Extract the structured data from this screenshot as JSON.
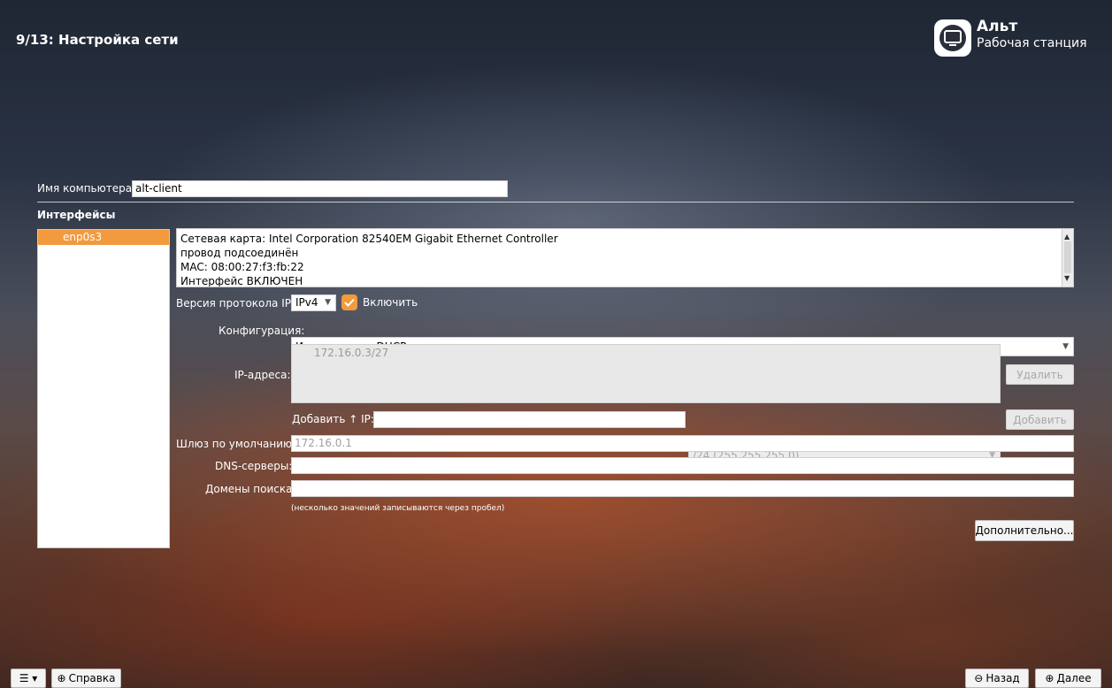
{
  "header": {
    "title": "9/13: Настройка сети",
    "brand": "Альт",
    "brand_sub": "Рабочая станция"
  },
  "hostname": {
    "label": "Имя компьютера:",
    "value": "alt-client"
  },
  "interfaces": {
    "heading": "Интерфейсы",
    "items": [
      "enp0s3"
    ],
    "info_lines": [
      "Сетевая карта: Intel Corporation 82540EM Gigabit Ethernet Controller",
      "провод подсоединён",
      "MAC: 08:00:27:f3:fb:22",
      "Интерфейс ВКЛЮЧЕН"
    ]
  },
  "protocol": {
    "label": "Версия протокола IP:",
    "value": "IPv4",
    "enable_label": "Включить",
    "enabled": true
  },
  "config": {
    "label": "Конфигурация:",
    "value": "Использовать DHCP"
  },
  "ip": {
    "label": "IP-адреса:",
    "addresses": [
      "172.16.0.3/27"
    ],
    "delete_button": "Удалить",
    "add_label": "Добавить ↑ IP:",
    "add_value": "",
    "mask_value": "/24 (255.255.255.0)",
    "add_button": "Добавить"
  },
  "gateway": {
    "label": "Шлюз по умолчанию:",
    "value": "172.16.0.1"
  },
  "dns": {
    "label": "DNS-серверы:",
    "value": ""
  },
  "domains": {
    "label": "Домены поиска:",
    "value": "",
    "hint": "(несколько значений записываются через пробел)"
  },
  "advanced_button": "Дополнительно...",
  "footer": {
    "help_label": "Справка",
    "back_label": "Назад",
    "next_label": "Далее"
  }
}
